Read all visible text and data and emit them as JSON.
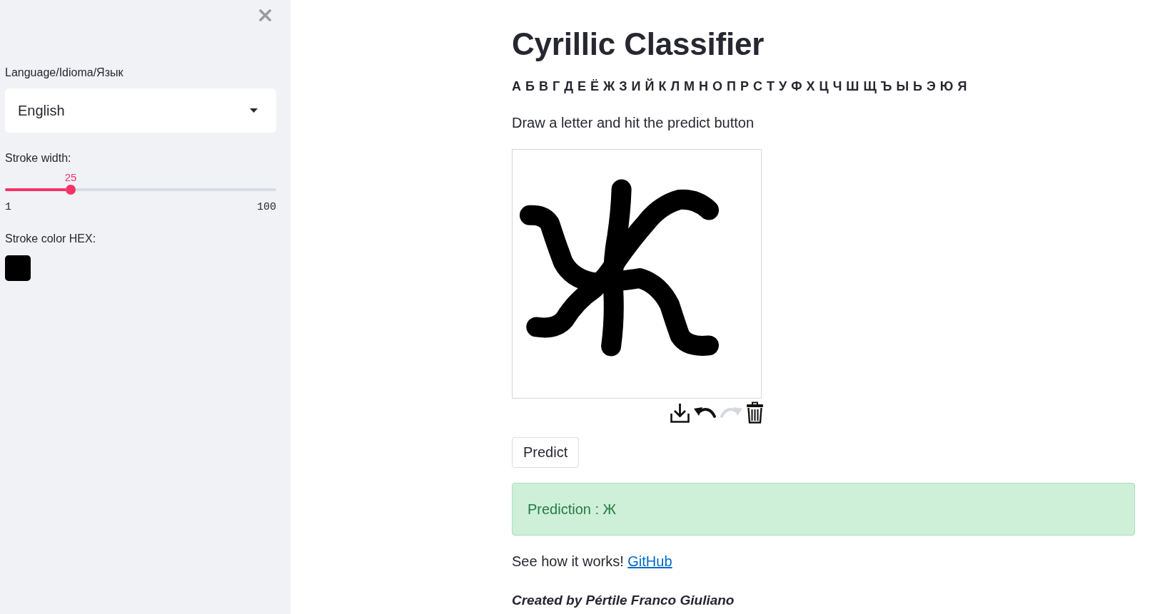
{
  "sidebar": {
    "language": {
      "label": "Language/Idioma/Язык",
      "value": "English"
    },
    "stroke_width": {
      "label": "Stroke width:",
      "value": "25",
      "min": "1",
      "max": "100",
      "level": 0.2424
    },
    "stroke_color": {
      "label": "Stroke color HEX:",
      "color": "#000000"
    }
  },
  "main": {
    "title": "Cyrillic Classifier",
    "alphabet": "А Б В Г Д Е Ё Ж З И Й К Л М Н О П Р С Т У Ф Х Ц Ч Ш Щ Ъ Ы Ь Э Ю Я",
    "instruction": "Draw a letter and hit the predict button",
    "canvas_toolbar": [
      {
        "kind": "download",
        "disabled": false
      },
      {
        "kind": "undo",
        "disabled": false
      },
      {
        "kind": "redo",
        "disabled": true
      },
      {
        "kind": "delete",
        "disabled": false
      }
    ],
    "predict_button": "Predict",
    "prediction": "Prediction : Ж",
    "footer": {
      "text": "See how it works!",
      "link": "GitHub"
    },
    "credit": "Created by Pértile Franco Giuliano"
  }
}
